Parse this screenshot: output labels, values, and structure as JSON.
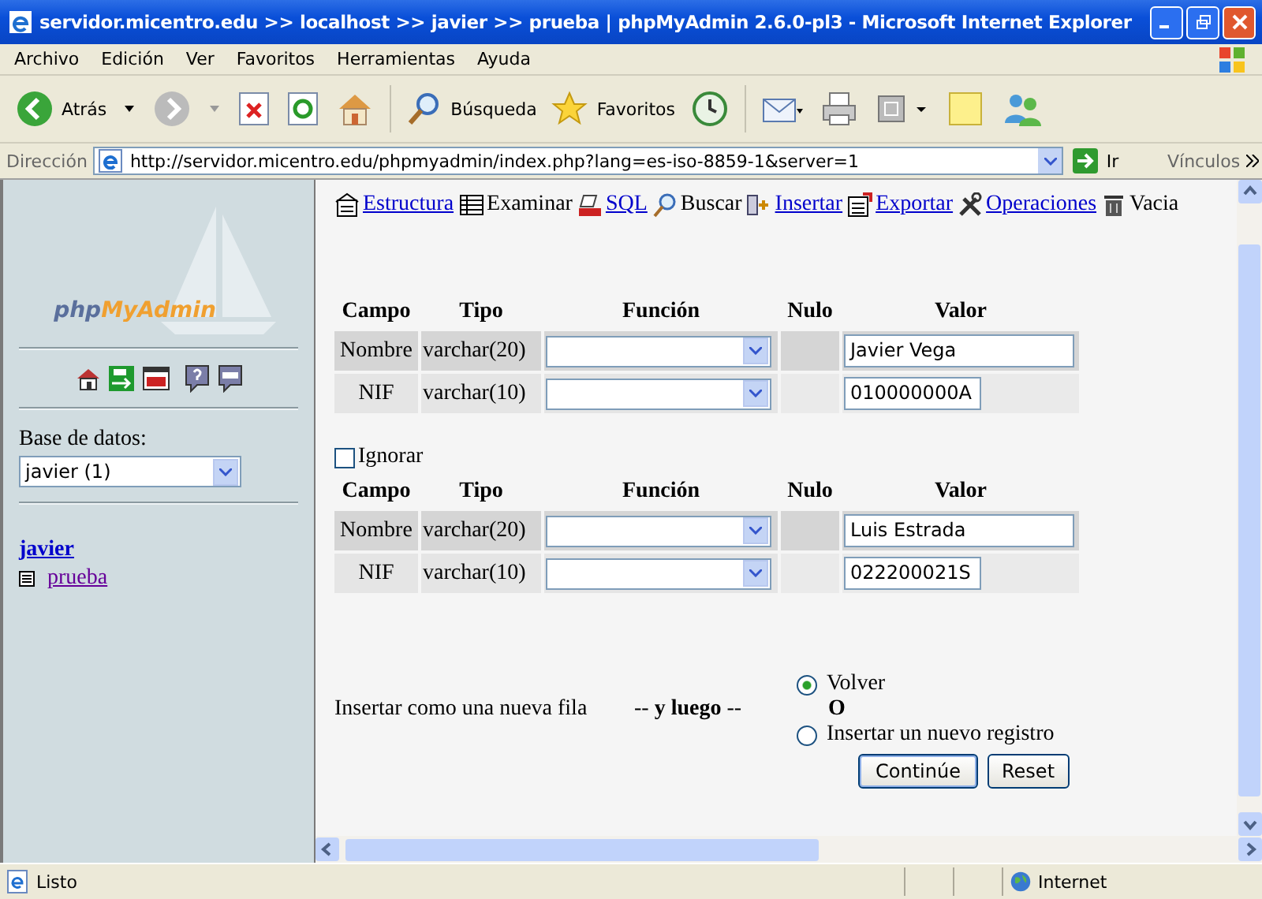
{
  "window": {
    "title": "servidor.micentro.edu >> localhost >> javier >> prueba | phpMyAdmin 2.6.0-pl3 - Microsoft Internet Explorer"
  },
  "menu": [
    "Archivo",
    "Edición",
    "Ver",
    "Favoritos",
    "Herramientas",
    "Ayuda"
  ],
  "toolbar": {
    "back": "Atrás",
    "search": "Búsqueda",
    "favorites": "Favoritos"
  },
  "address_bar": {
    "label": "Dirección",
    "url": "http://servidor.micentro.edu/phpmyadmin/index.php?lang=es-iso-8859-1&server=1",
    "go": "Ir",
    "links": "Vínculos"
  },
  "sidebar": {
    "logo_prefix": "php",
    "logo_suffix": "MyAdmin",
    "database_label": "Base de datos:",
    "database_select": "javier (1)",
    "database_link": "javier",
    "tables": [
      "prueba"
    ]
  },
  "tabs": [
    {
      "label": "Estructura",
      "disabled": false
    },
    {
      "label": "Examinar",
      "disabled": true
    },
    {
      "label": "SQL",
      "disabled": false
    },
    {
      "label": "Buscar",
      "disabled": true
    },
    {
      "label": "Insertar",
      "disabled": false
    },
    {
      "label": "Exportar",
      "disabled": false
    },
    {
      "label": "Operaciones",
      "disabled": false
    },
    {
      "label": "Vacia",
      "disabled": true
    }
  ],
  "records": [
    {
      "columns": [
        "Campo",
        "Tipo",
        "Función",
        "Nulo",
        "Valor"
      ],
      "fields": [
        {
          "campo": "Nombre",
          "tipo": "varchar(20)",
          "valor": "Javier Vega"
        },
        {
          "campo": "NIF",
          "tipo": "varchar(10)",
          "valor": "010000000A"
        }
      ]
    },
    {
      "ignore": {
        "label": "Ignorar",
        "checked": false
      },
      "columns": [
        "Campo",
        "Tipo",
        "Función",
        "Nulo",
        "Valor"
      ],
      "fields": [
        {
          "campo": "Nombre",
          "tipo": "varchar(20)",
          "valor": "Luis Estrada"
        },
        {
          "campo": "NIF",
          "tipo": "varchar(10)",
          "valor": "022200021S"
        }
      ]
    }
  ],
  "after_insert": {
    "label": "Insertar como una nueva fila",
    "then": "-- **y luego** --",
    "options": [
      {
        "label": "Volver",
        "selected": true
      },
      {
        "label": "Insertar un nuevo registro",
        "selected": false
      }
    ],
    "or": "O"
  },
  "buttons": [
    "Continúe",
    "Reset"
  ],
  "status_bar": {
    "text": "Listo",
    "zone": "Internet"
  }
}
